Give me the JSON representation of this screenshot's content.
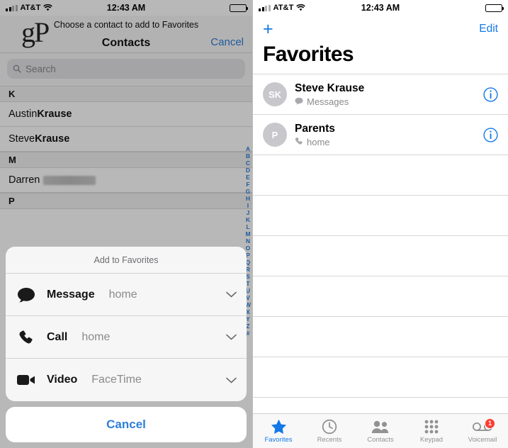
{
  "left_screen": {
    "status": {
      "carrier": "AT&T",
      "time": "12:43 AM",
      "signal_icon": "signal-bars-icon",
      "wifi_icon": "wifi-icon",
      "battery_icon": "battery-full-icon"
    },
    "prompt": "Choose a contact to add to Favorites",
    "nav": {
      "title": "Contacts",
      "cancel": "Cancel"
    },
    "search": {
      "placeholder": "Search",
      "icon": "search-icon"
    },
    "sections": [
      {
        "letter": "K",
        "rows": [
          {
            "first": "Austin ",
            "last": "Krause"
          },
          {
            "first": "Steve ",
            "last": "Krause"
          }
        ]
      },
      {
        "letter": "M",
        "rows": [
          {
            "first": "Darren ",
            "last": ""
          }
        ]
      },
      {
        "letter": "P",
        "rows": []
      }
    ],
    "index_letters": [
      "A",
      "B",
      "C",
      "D",
      "E",
      "F",
      "G",
      "H",
      "I",
      "J",
      "K",
      "L",
      "M",
      "N",
      "O",
      "P",
      "Q",
      "R",
      "S",
      "T",
      "U",
      "V",
      "W",
      "X",
      "Y",
      "Z",
      "#"
    ],
    "action_sheet": {
      "title": "Add to Favorites",
      "options": [
        {
          "icon": "message-bubble-icon",
          "label": "Message",
          "value": "home",
          "chevron": "chevron-down-icon"
        },
        {
          "icon": "phone-handset-icon",
          "label": "Call",
          "value": "home",
          "chevron": "chevron-down-icon"
        },
        {
          "icon": "video-camera-icon",
          "label": "Video",
          "value": "FaceTime",
          "chevron": "chevron-down-icon"
        }
      ],
      "cancel": "Cancel"
    },
    "watermark": "gP"
  },
  "right_screen": {
    "status": {
      "carrier": "AT&T",
      "time": "12:43 AM",
      "signal_icon": "signal-bars-icon",
      "wifi_icon": "wifi-icon",
      "battery_icon": "battery-full-icon"
    },
    "nav": {
      "add": "+",
      "edit": "Edit"
    },
    "title": "Favorites",
    "favorites": [
      {
        "initials": "SK",
        "name": "Steve Krause",
        "type_icon": "message-bubble-icon",
        "type": "Messages",
        "info_icon": "info-circle-icon"
      },
      {
        "initials": "P",
        "name": "Parents",
        "type_icon": "phone-handset-icon",
        "type": "home",
        "info_icon": "info-circle-icon"
      }
    ],
    "empty_rows": 6,
    "tabs": [
      {
        "label": "Favorites",
        "icon": "star-icon",
        "active": true,
        "badge": ""
      },
      {
        "label": "Recents",
        "icon": "clock-icon",
        "active": false,
        "badge": ""
      },
      {
        "label": "Contacts",
        "icon": "contacts-icon",
        "active": false,
        "badge": ""
      },
      {
        "label": "Keypad",
        "icon": "keypad-icon",
        "active": false,
        "badge": ""
      },
      {
        "label": "Voicemail",
        "icon": "voicemail-icon",
        "active": false,
        "badge": "1"
      }
    ]
  },
  "colors": {
    "accent": "#1478e8",
    "link": "#2f7fd8",
    "badge": "#ff3b30",
    "muted": "#8a8a8e"
  }
}
